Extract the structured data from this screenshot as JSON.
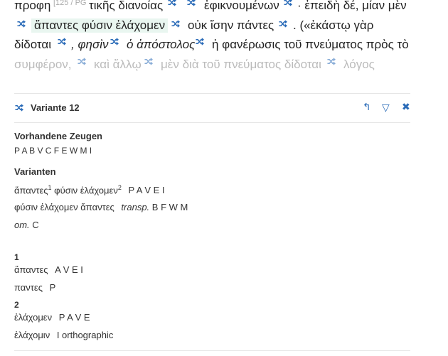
{
  "text_lines": {
    "line1": {
      "w1": "προφη",
      "ref": "[125 / PG",
      "w2": "τικῆς διανοίας",
      "w3": "ἐφικνουμένων",
      "w4": "· ἐπειδὴ δέ, μίαν μὲν"
    },
    "line2": {
      "w1": "ἅπαντες φύσιν ἐλάχομεν",
      "w2": "οὐκ ἴσην πάντες",
      "w3": ". («ἑκάστῳ γὰρ"
    },
    "line3": {
      "w1": "δίδοται",
      "w2": ", φησὶν",
      "w3": "ὁ ἀπόστολος",
      "w4": "ἡ φανέρωσις τοῦ πνεύματος πρὸς τὸ"
    },
    "line4": {
      "w1": "συμφέρον,",
      "w2": "καὶ ἄλλῳ",
      "w3": "μὲν διὰ τοῦ πνεύματος δίδοται",
      "w4": "λόγος"
    }
  },
  "panel": {
    "title": "Variante 12",
    "controls": {
      "back": "↰",
      "filter": "▽",
      "close": "✖"
    },
    "witnesses_heading": "Vorhandene Zeugen",
    "witnesses": "P A B V C F E W M I",
    "variants_heading": "Varianten",
    "variants": [
      {
        "text_a": "ἅπαντες",
        "sup_a": "1",
        "text_b": "φύσιν ἐλάχομεν",
        "sup_b": "2",
        "sigla": "P A V E I"
      },
      {
        "text": "φύσιν ἐλάχομεν ἅπαντες",
        "note": "transp.",
        "sigla": "B F W M"
      },
      {
        "note": "om.",
        "sigla": "C"
      }
    ],
    "sub1": {
      "num": "1",
      "rows": [
        {
          "text": "ἅπαντες",
          "sigla": "A V E I"
        },
        {
          "text": "παντες",
          "sigla": "P"
        }
      ]
    },
    "sub2": {
      "num": "2",
      "rows": [
        {
          "text": "ἐλάχομεν",
          "sigla": "P A V E"
        },
        {
          "text": "ἐλάχομιν",
          "sigla": "I orthographic"
        }
      ]
    }
  },
  "colors": {
    "icon_blue": "#2a6bb8",
    "highlight": "#e9f6f0",
    "divider": "#e6e6e6"
  }
}
